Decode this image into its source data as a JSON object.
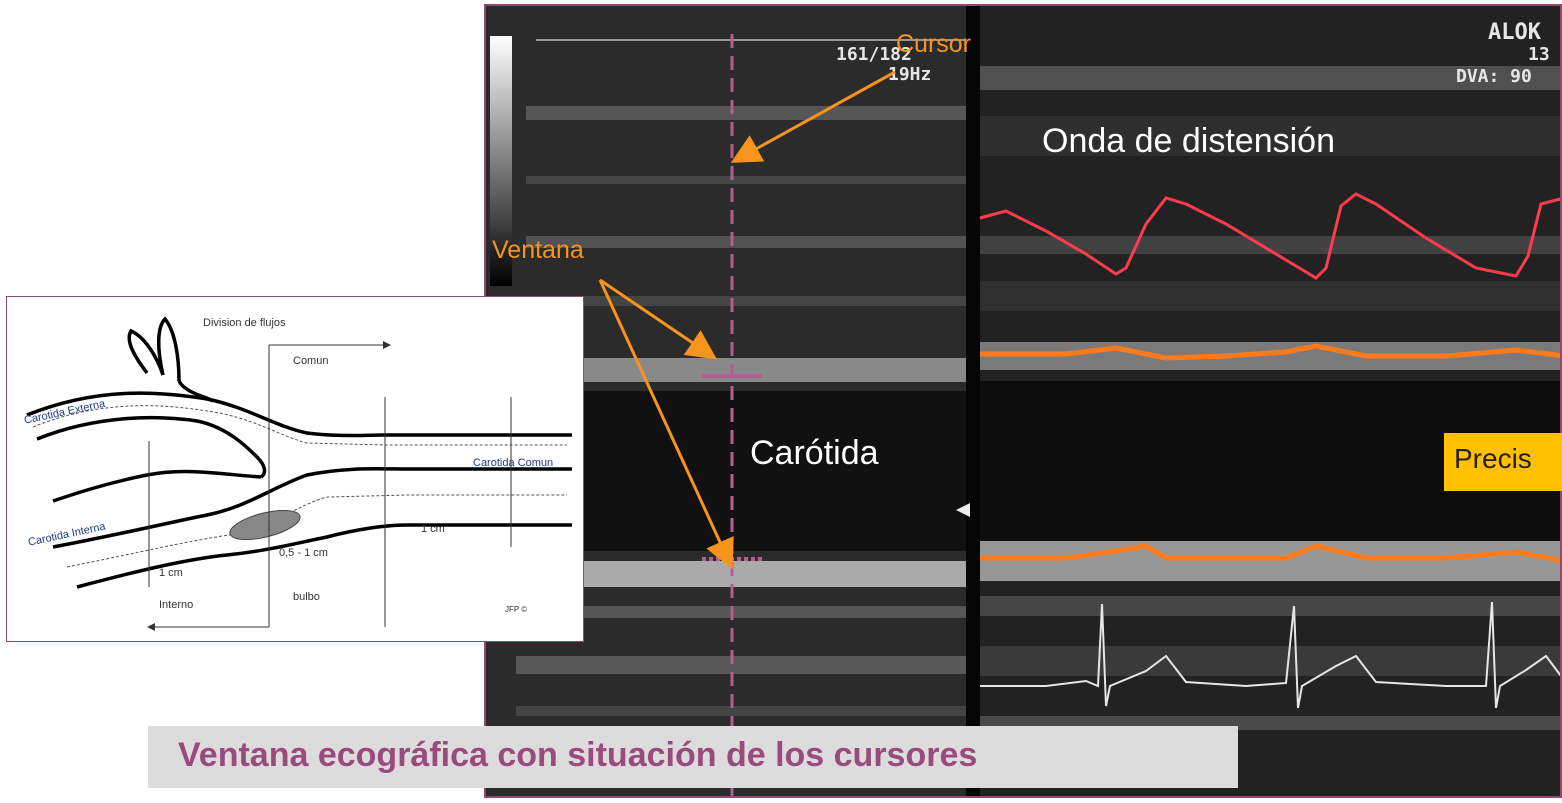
{
  "ultrasound": {
    "hud_frame_rate": "161/182",
    "hud_hz": "19Hz",
    "hud_brand": "ALOK",
    "hud_num": "13",
    "hud_dva": "DVA: 90"
  },
  "labels": {
    "cursor": "Cursor",
    "ventana": "Ventana",
    "onda": "Onda de distensión",
    "carotida": "Carótida",
    "precision": "Precis"
  },
  "diagram": {
    "division": "Division de flujos",
    "comun": "Comun",
    "carotida_externa": "Carotida Externa",
    "carotida_interna": "Carotida Interna",
    "carotida_comun": "Carotida Comun",
    "one_cm_right": "1 cm",
    "bulbo_size": "0,5 - 1 cm",
    "one_cm_left": "1 cm",
    "interno": "Interno",
    "bulbo": "bulbo",
    "signature": "JFP ©"
  },
  "caption": "Ventana ecográfica con situación de los cursores",
  "colors": {
    "frame": "#8e4a70",
    "orange": "#f7941d",
    "red_wave": "#ff3b4e",
    "wall_trace": "#ff7a1a",
    "caption_text": "#9a4a7c",
    "precision_bg": "#ffc000"
  }
}
